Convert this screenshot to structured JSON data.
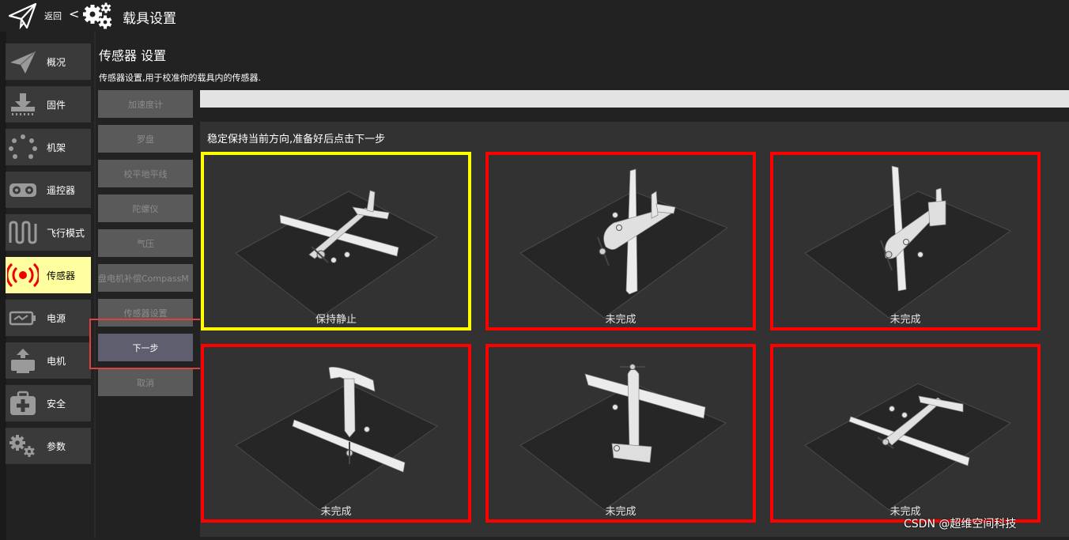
{
  "header": {
    "back_label": "返回",
    "back_arrow": "<",
    "title": "载具设置"
  },
  "sidebar": {
    "items": [
      {
        "label": "概况",
        "icon": "paper-plane-icon"
      },
      {
        "label": "固件",
        "icon": "download-icon"
      },
      {
        "label": "机架",
        "icon": "dots-circle-icon"
      },
      {
        "label": "遥控器",
        "icon": "remote-control-icon"
      },
      {
        "label": "飞行模式",
        "icon": "wave-icon"
      },
      {
        "label": "传感器",
        "icon": "radio-signal-icon"
      },
      {
        "label": "电源",
        "icon": "battery-icon"
      },
      {
        "label": "电机",
        "icon": "motor-icon"
      },
      {
        "label": "安全",
        "icon": "medkit-icon"
      },
      {
        "label": "参数",
        "icon": "gears-icon"
      }
    ],
    "active_index": 5
  },
  "page": {
    "title": "传感器 设置",
    "description": "传感器设置,用于校准你的载具内的传感器."
  },
  "sensor_buttons": [
    "加速度计",
    "罗盘",
    "校平地平线",
    "陀螺仪",
    "气压",
    "盘电机补偿CompassM",
    "传感器设置",
    "下一步",
    "取消"
  ],
  "calibration": {
    "instruction": "稳定保持当前方向,准备好后点击下一步",
    "progress": 0,
    "orientations": [
      {
        "caption": "保持静止",
        "state": "current"
      },
      {
        "caption": "未完成",
        "state": "incomplete"
      },
      {
        "caption": "未完成",
        "state": "incomplete"
      },
      {
        "caption": "未完成",
        "state": "incomplete"
      },
      {
        "caption": "未完成",
        "state": "incomplete"
      },
      {
        "caption": "未完成",
        "state": "incomplete"
      }
    ]
  },
  "watermark": "CSDN @超维空间科技",
  "colors": {
    "active_nav": "#ffffa0",
    "current_border": "#ffff00",
    "incomplete_border": "#ff0000",
    "highlight_box": "#e04040"
  }
}
